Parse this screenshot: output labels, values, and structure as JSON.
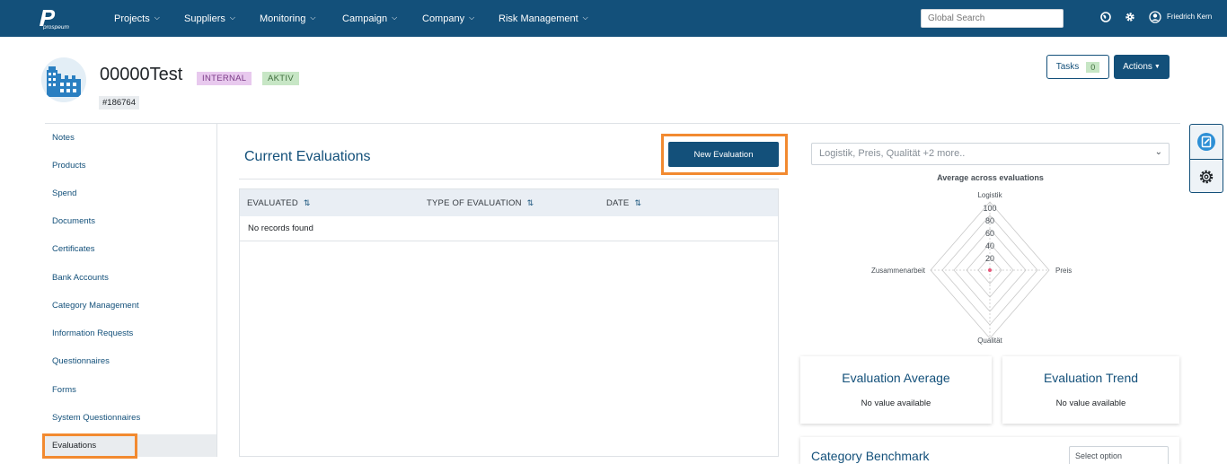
{
  "topbar": {
    "brand": "prospeum",
    "nav": [
      {
        "label": "Projects"
      },
      {
        "label": "Suppliers"
      },
      {
        "label": "Monitoring"
      },
      {
        "label": "Campaign"
      },
      {
        "label": "Company"
      },
      {
        "label": "Risk Management"
      }
    ],
    "search_placeholder": "Global Search",
    "user_name": "Friedrich Kern",
    "icons": [
      "globe-icon",
      "gear-icon",
      "user-icon"
    ]
  },
  "supplier": {
    "name": "00000Test",
    "badges": [
      "INTERNAL",
      "AKTIV"
    ],
    "id": "#186764"
  },
  "header_actions": {
    "tasks_label": "Tasks",
    "tasks_count": "0",
    "actions_label": "Actions"
  },
  "sidebar": {
    "items": [
      {
        "label": "Notes"
      },
      {
        "label": "Products"
      },
      {
        "label": "Spend"
      },
      {
        "label": "Documents"
      },
      {
        "label": "Certificates"
      },
      {
        "label": "Bank Accounts"
      },
      {
        "label": "Category Management"
      },
      {
        "label": "Information Requests"
      },
      {
        "label": "Questionnaires"
      },
      {
        "label": "Forms"
      },
      {
        "label": "System Questionnaires"
      },
      {
        "label": "Evaluations"
      }
    ],
    "active": "Evaluations"
  },
  "evaluations": {
    "title": "Current Evaluations",
    "new_button": "New Evaluation",
    "columns": [
      "EVALUATED",
      "TYPE OF EVALUATION",
      "DATE"
    ],
    "empty_text": "No records found"
  },
  "radar": {
    "filter_placeholder": "Logistik, Preis, Qualität +2 more..",
    "title": "Average across evaluations",
    "axes": [
      "Logistik",
      "Preis",
      "Qualität",
      "Zusammenarbeit"
    ],
    "ticks": [
      "100",
      "80",
      "60",
      "40",
      "20"
    ],
    "grid_color": "#c9c9c9",
    "point_color": "#e8577a"
  },
  "cards": {
    "average": {
      "title": "Evaluation Average",
      "value": "No value available"
    },
    "trend": {
      "title": "Evaluation Trend",
      "value": "No value available"
    },
    "benchmark": {
      "title": "Category Benchmark",
      "select": "Select option"
    }
  },
  "colors": {
    "primary": "#13507a",
    "highlight": "#f28a30"
  }
}
